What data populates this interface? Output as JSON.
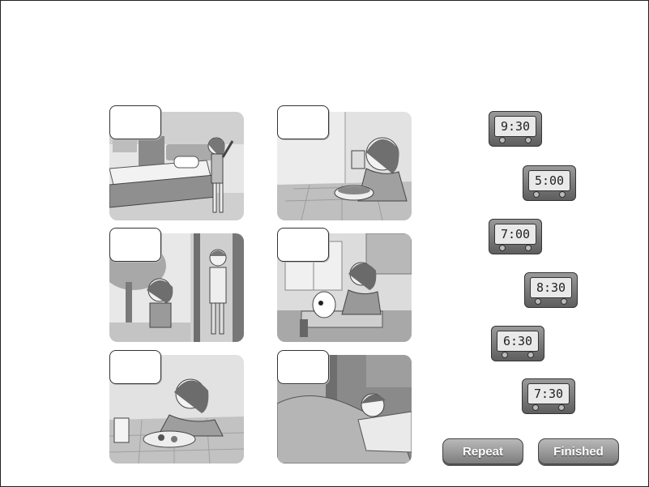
{
  "clocks": [
    "9:30",
    "5:00",
    "7:00",
    "8:30",
    "6:30",
    "7:30"
  ],
  "buttons": {
    "repeat": "Repeat",
    "finished": "Finished"
  },
  "scenes": [
    "waking-up",
    "eating-breakfast",
    "walking-to-school",
    "washing-dishes",
    "eating-dinner",
    "sleeping"
  ],
  "colors": {
    "panel_bg": "#e4e4e4",
    "clock_body": "#777777",
    "button": "#9a9a9a"
  }
}
